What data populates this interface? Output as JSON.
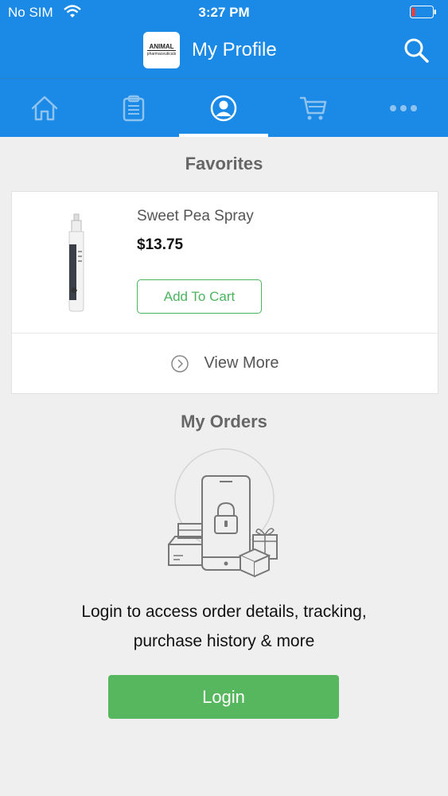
{
  "status_bar": {
    "carrier": "No SIM",
    "time": "3:27 PM",
    "wifi_icon": "wifi-icon",
    "battery_icon": "battery-low-icon"
  },
  "header": {
    "title": "My Profile",
    "logo": {
      "line1": "ANIMAL",
      "line2": "pharmaceuticals"
    },
    "search_icon": "search-icon",
    "brand_color": "#1a8ae6"
  },
  "tabs": [
    {
      "name": "home",
      "icon": "home-icon",
      "active": false
    },
    {
      "name": "orders",
      "icon": "clipboard-icon",
      "active": false
    },
    {
      "name": "profile",
      "icon": "user-icon",
      "active": true
    },
    {
      "name": "cart",
      "icon": "cart-icon",
      "active": false
    },
    {
      "name": "more",
      "icon": "more-icon",
      "active": false
    }
  ],
  "favorites": {
    "title": "Favorites",
    "items": [
      {
        "name": "Sweet Pea Spray",
        "price": "$13.75",
        "button_label": "Add To Cart"
      }
    ],
    "view_more_label": "View More"
  },
  "orders": {
    "title": "My Orders",
    "message_line1": "Login to access order details, tracking,",
    "message_line2": "purchase history & more",
    "login_label": "Login",
    "login_color": "#57b75f"
  }
}
